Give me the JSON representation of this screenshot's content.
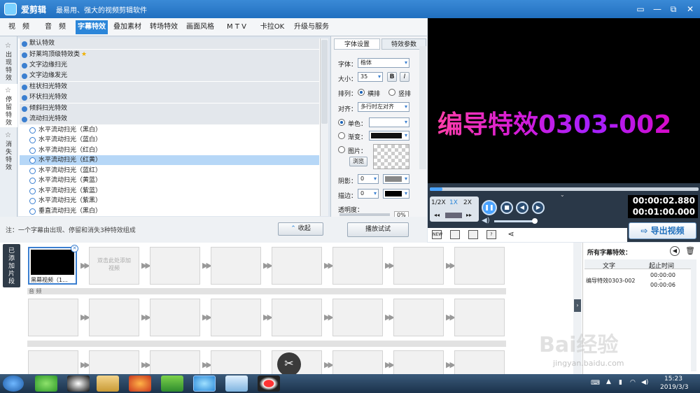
{
  "app": {
    "name": "爱剪辑",
    "slogan": "最易用、强大的视频剪辑软件"
  },
  "window": {
    "restore": "⧉",
    "close": "✕",
    "min": "—"
  },
  "tabs": [
    {
      "label": "视　频"
    },
    {
      "label": "音　频"
    },
    {
      "label": "字幕特效"
    },
    {
      "label": "叠加素材"
    },
    {
      "label": "转场特效"
    },
    {
      "label": "画面风格"
    },
    {
      "label": "M T V"
    },
    {
      "label": "卡拉OK"
    },
    {
      "label": "升级与服务"
    }
  ],
  "side_tabs": [
    {
      "label": "出现特效"
    },
    {
      "label": "停留特效"
    },
    {
      "label": "消失特效"
    }
  ],
  "categories": [
    {
      "label": "默认特效"
    },
    {
      "label": "好莱坞顶级特效类"
    },
    {
      "label": "文字边缘扫光"
    },
    {
      "label": "文字边缘发光"
    },
    {
      "label": "柱状扫光特效"
    },
    {
      "label": "环状扫光特效"
    },
    {
      "label": "倾斜扫光特效"
    },
    {
      "label": "流动扫光特效"
    }
  ],
  "items": [
    {
      "label": "水平流动扫光（黑白）"
    },
    {
      "label": "水平流动扫光（蓝白）"
    },
    {
      "label": "水平流动扫光（红白）"
    },
    {
      "label": "水平流动扫光（红黄）"
    },
    {
      "label": "水平流动扫光（蓝红）"
    },
    {
      "label": "水平流动扫光（黄蓝）"
    },
    {
      "label": "水平流动扫光（紫蓝）"
    },
    {
      "label": "水平流动扫光（紫黑）"
    },
    {
      "label": "垂直流动扫光（黑白）"
    }
  ],
  "note": "注：一个字幕由出现、停留和消失3种特效组成",
  "collect": "收起",
  "props": {
    "tab_font": "字体设置",
    "tab_effect": "特效参数",
    "font_label": "字体：",
    "font_value": "楷体",
    "size_label": "大小：",
    "size_value": "35",
    "bold": "B",
    "italic": "I",
    "layout_label": "排列：",
    "horizontal": "横排",
    "vertical": "竖排",
    "align_label": "对齐：",
    "align_value": "多行时左对齐",
    "solid": "单色：",
    "gradient": "渐变：",
    "image": "图片：",
    "browse": "浏览",
    "shadow_label": "阴影：",
    "shadow_value": "0",
    "stroke_label": "描边：",
    "stroke_value": "0",
    "opacity_label": "透明度：",
    "opacity_value": "0%",
    "play_test": "播放试试"
  },
  "preview": {
    "text": "编导特效0303-002",
    "speeds": [
      "1/2X",
      "1X",
      "2X"
    ],
    "time_current": "00:00:02.880",
    "time_total": "00:01:00.000",
    "export": "导出视频"
  },
  "timeline": {
    "added_label": "已添加片段",
    "clip_name": "黑幕视频（1...",
    "empty_hint": "双击此处添加视频",
    "audio_label": "音  频",
    "close": "✕"
  },
  "subtitles": {
    "title": "所有字幕特效：",
    "col_text": "文字",
    "col_time": "起止时间",
    "row_text": "编导特效0303-002",
    "row_start": "00:00:00",
    "row_end": "00:00:06",
    "sep": "--"
  },
  "taskbar": {
    "time": "15:23",
    "date": "2019/3/3"
  },
  "watermark": {
    "text": "Bai经验",
    "sub": "jingyan.baidu.com"
  }
}
